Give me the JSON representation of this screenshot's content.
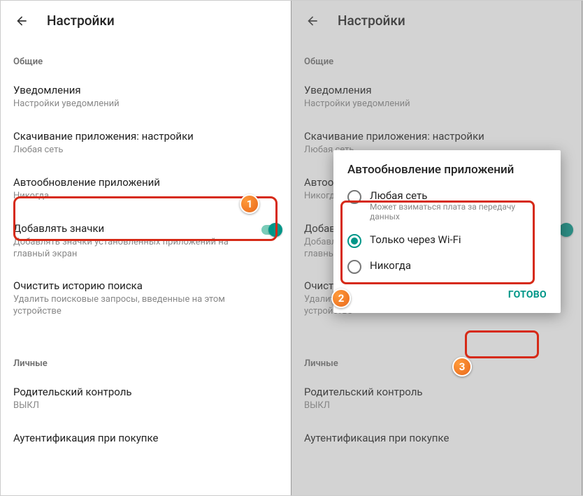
{
  "header": {
    "title": "Настройки"
  },
  "sections": {
    "general": {
      "label": "Общие",
      "notifications": {
        "title": "Уведомления",
        "sub": "Настройки уведомлений"
      },
      "download": {
        "title": "Скачивание приложения: настройки",
        "sub": "Любая сеть"
      },
      "autoupdate": {
        "title": "Автообновление приложений",
        "sub": "Никогда"
      },
      "icons": {
        "title": "Добавлять значки",
        "sub": "Добавлять значки установленных приложений на главный экран"
      },
      "clear": {
        "title": "Очистить историю поиска",
        "sub": "Удалить поисковые запросы, введенные на этом устройстве"
      }
    },
    "personal": {
      "label": "Личные",
      "parental": {
        "title": "Родительский контроль",
        "sub": "ВЫКЛ"
      },
      "auth": {
        "title": "Аутентификация при покупке"
      }
    }
  },
  "dialog": {
    "title": "Автообновление приложений",
    "opt_any": {
      "label": "Любая сеть",
      "sub": "Может взиматься плата за передачу данных"
    },
    "opt_wifi": {
      "label": "Только через Wi-Fi"
    },
    "opt_never": {
      "label": "Никогда"
    },
    "done": "ГОТОВО"
  },
  "badges": {
    "one": "1",
    "two": "2",
    "three": "3"
  }
}
